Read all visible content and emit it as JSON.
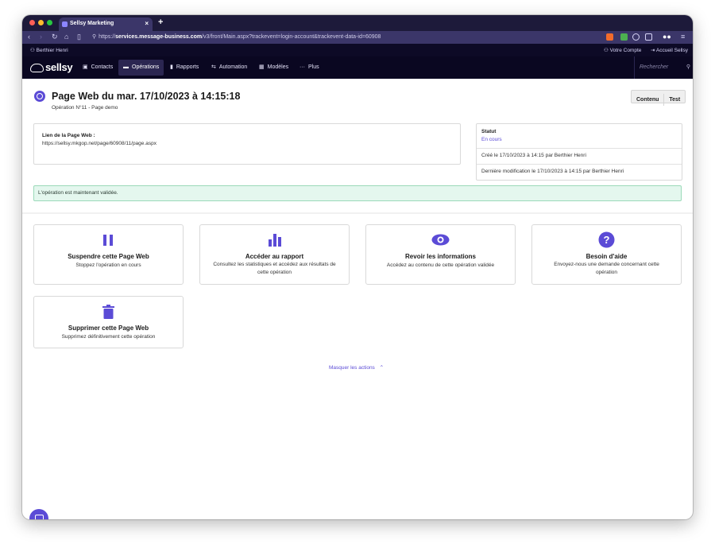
{
  "browser": {
    "tab_title": "Sellsy Marketing",
    "tab_close": "×",
    "new_tab": "+",
    "url_prefix": "https://",
    "url_host": "services.message-business.com",
    "url_path": "/v3/front/Main.aspx?trackevent=login-account&trackevent-data-id=60908"
  },
  "userbar": {
    "user_name": "Berthier Henri",
    "account": "Votre Compte",
    "home": "Accueil Sellsy"
  },
  "nav": {
    "logo": "sellsy",
    "items": [
      {
        "label": "Contacts",
        "icon": "contacts-icon"
      },
      {
        "label": "Opérations",
        "icon": "folder-icon",
        "active": true
      },
      {
        "label": "Rapports",
        "icon": "bar-chart-icon"
      },
      {
        "label": "Automation",
        "icon": "automation-icon"
      },
      {
        "label": "Modèles",
        "icon": "grid-icon"
      },
      {
        "label": "Plus",
        "icon": "more-icon"
      }
    ],
    "search_placeholder": "Rechercher"
  },
  "page": {
    "title": "Page Web du mar. 17/10/2023 à 14:15:18",
    "subtitle": "Opération N°11 - Page demo",
    "btn_content": "Contenu",
    "btn_test": "Test",
    "link_label": "Lien de la Page Web :",
    "link_value": "https://sellsy.mkgop.net/page/60908/11/page.aspx",
    "status_label": "Statut",
    "status_value": "En cours",
    "created": "Créé le 17/10/2023 à 14:15 par Berthier Henri",
    "modified": "Dernière modification le 17/10/2023 à 14:15 par Berthier Henri",
    "alert": "L'opération est maintenant validée.",
    "hide_actions": "Masquer les actions"
  },
  "actions": [
    {
      "title": "Suspendre cette Page Web",
      "desc": "Stoppez l'opération en cours",
      "icon": "pause-icon"
    },
    {
      "title": "Accéder au rapport",
      "desc": "Consultez les statistiques et accédez aux résultats de cette opération",
      "icon": "bar-chart-icon"
    },
    {
      "title": "Revoir les informations",
      "desc": "Accédez au contenu de cette opération validée",
      "icon": "eye-icon"
    },
    {
      "title": "Besoin d'aide",
      "desc": "Envoyez-nous une demande concernant cette opération",
      "icon": "help-icon"
    },
    {
      "title": "Supprimer cette Page Web",
      "desc": "Supprimez définitivement cette opération",
      "icon": "trash-icon"
    }
  ],
  "colors": {
    "accent": "#5b4bd6",
    "nav_bg": "#0a0721",
    "alert_bg": "#e4f7ee"
  }
}
